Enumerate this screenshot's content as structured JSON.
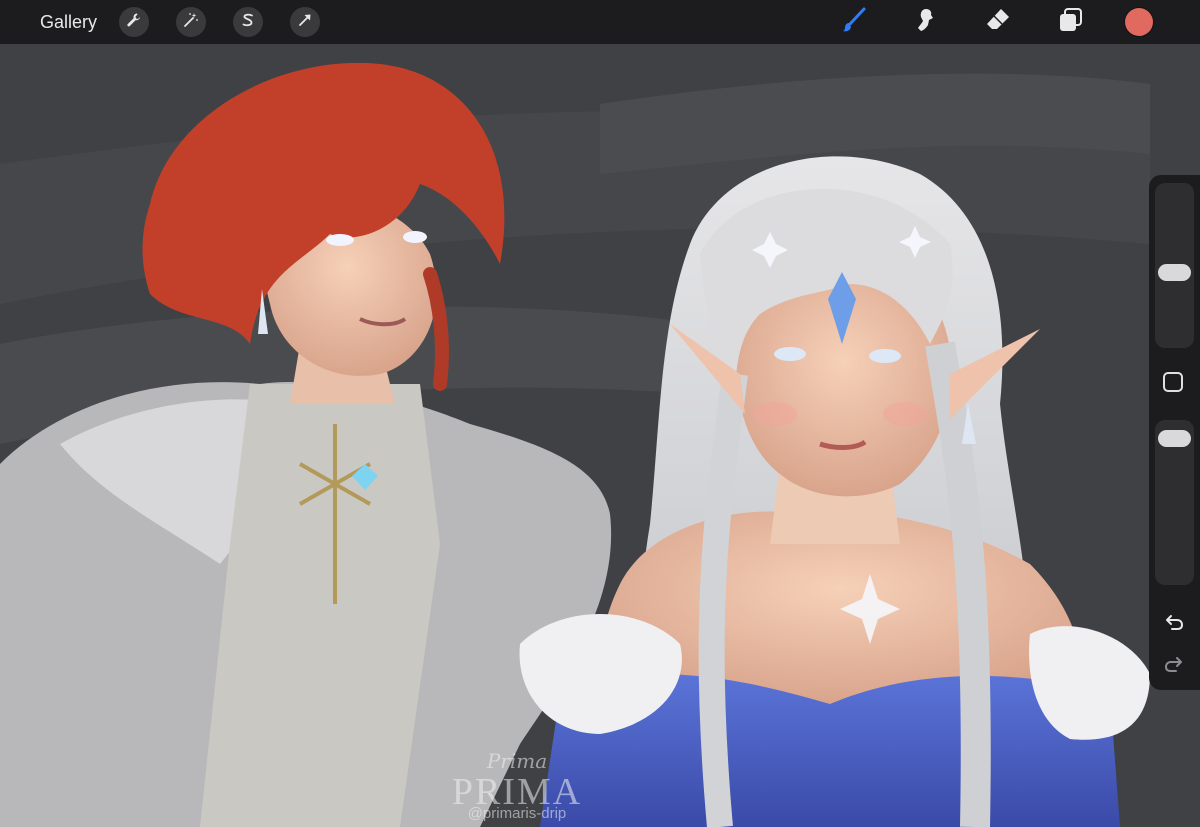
{
  "app": {
    "gallery_label": "Gallery"
  },
  "toolbar": {
    "left_tools": [
      {
        "name": "actions",
        "icon": "wrench-icon"
      },
      {
        "name": "adjustments",
        "icon": "magic-wand-icon"
      },
      {
        "name": "selection",
        "icon": "selection-s-icon"
      },
      {
        "name": "transform",
        "icon": "arrow-icon"
      }
    ],
    "right_tools": [
      {
        "name": "brush",
        "icon": "brush-icon",
        "active": true
      },
      {
        "name": "smudge",
        "icon": "smudge-icon",
        "active": false
      },
      {
        "name": "eraser",
        "icon": "eraser-icon",
        "active": false
      },
      {
        "name": "layers",
        "icon": "layers-icon",
        "active": false
      }
    ],
    "current_color": "#e06a5f",
    "active_tool_color": "#2f7df6"
  },
  "sidebar": {
    "brush_size_level": 0.45,
    "opacity_level": 0.05,
    "modifier_icon": "square-modifier-icon",
    "undo_icon": "undo-icon",
    "redo_icon": "redo-icon"
  },
  "canvas": {
    "background_color": "#404145",
    "watermark": {
      "signature": "Prima",
      "name": "PRIMA",
      "handle": "@primaris-drip"
    }
  }
}
